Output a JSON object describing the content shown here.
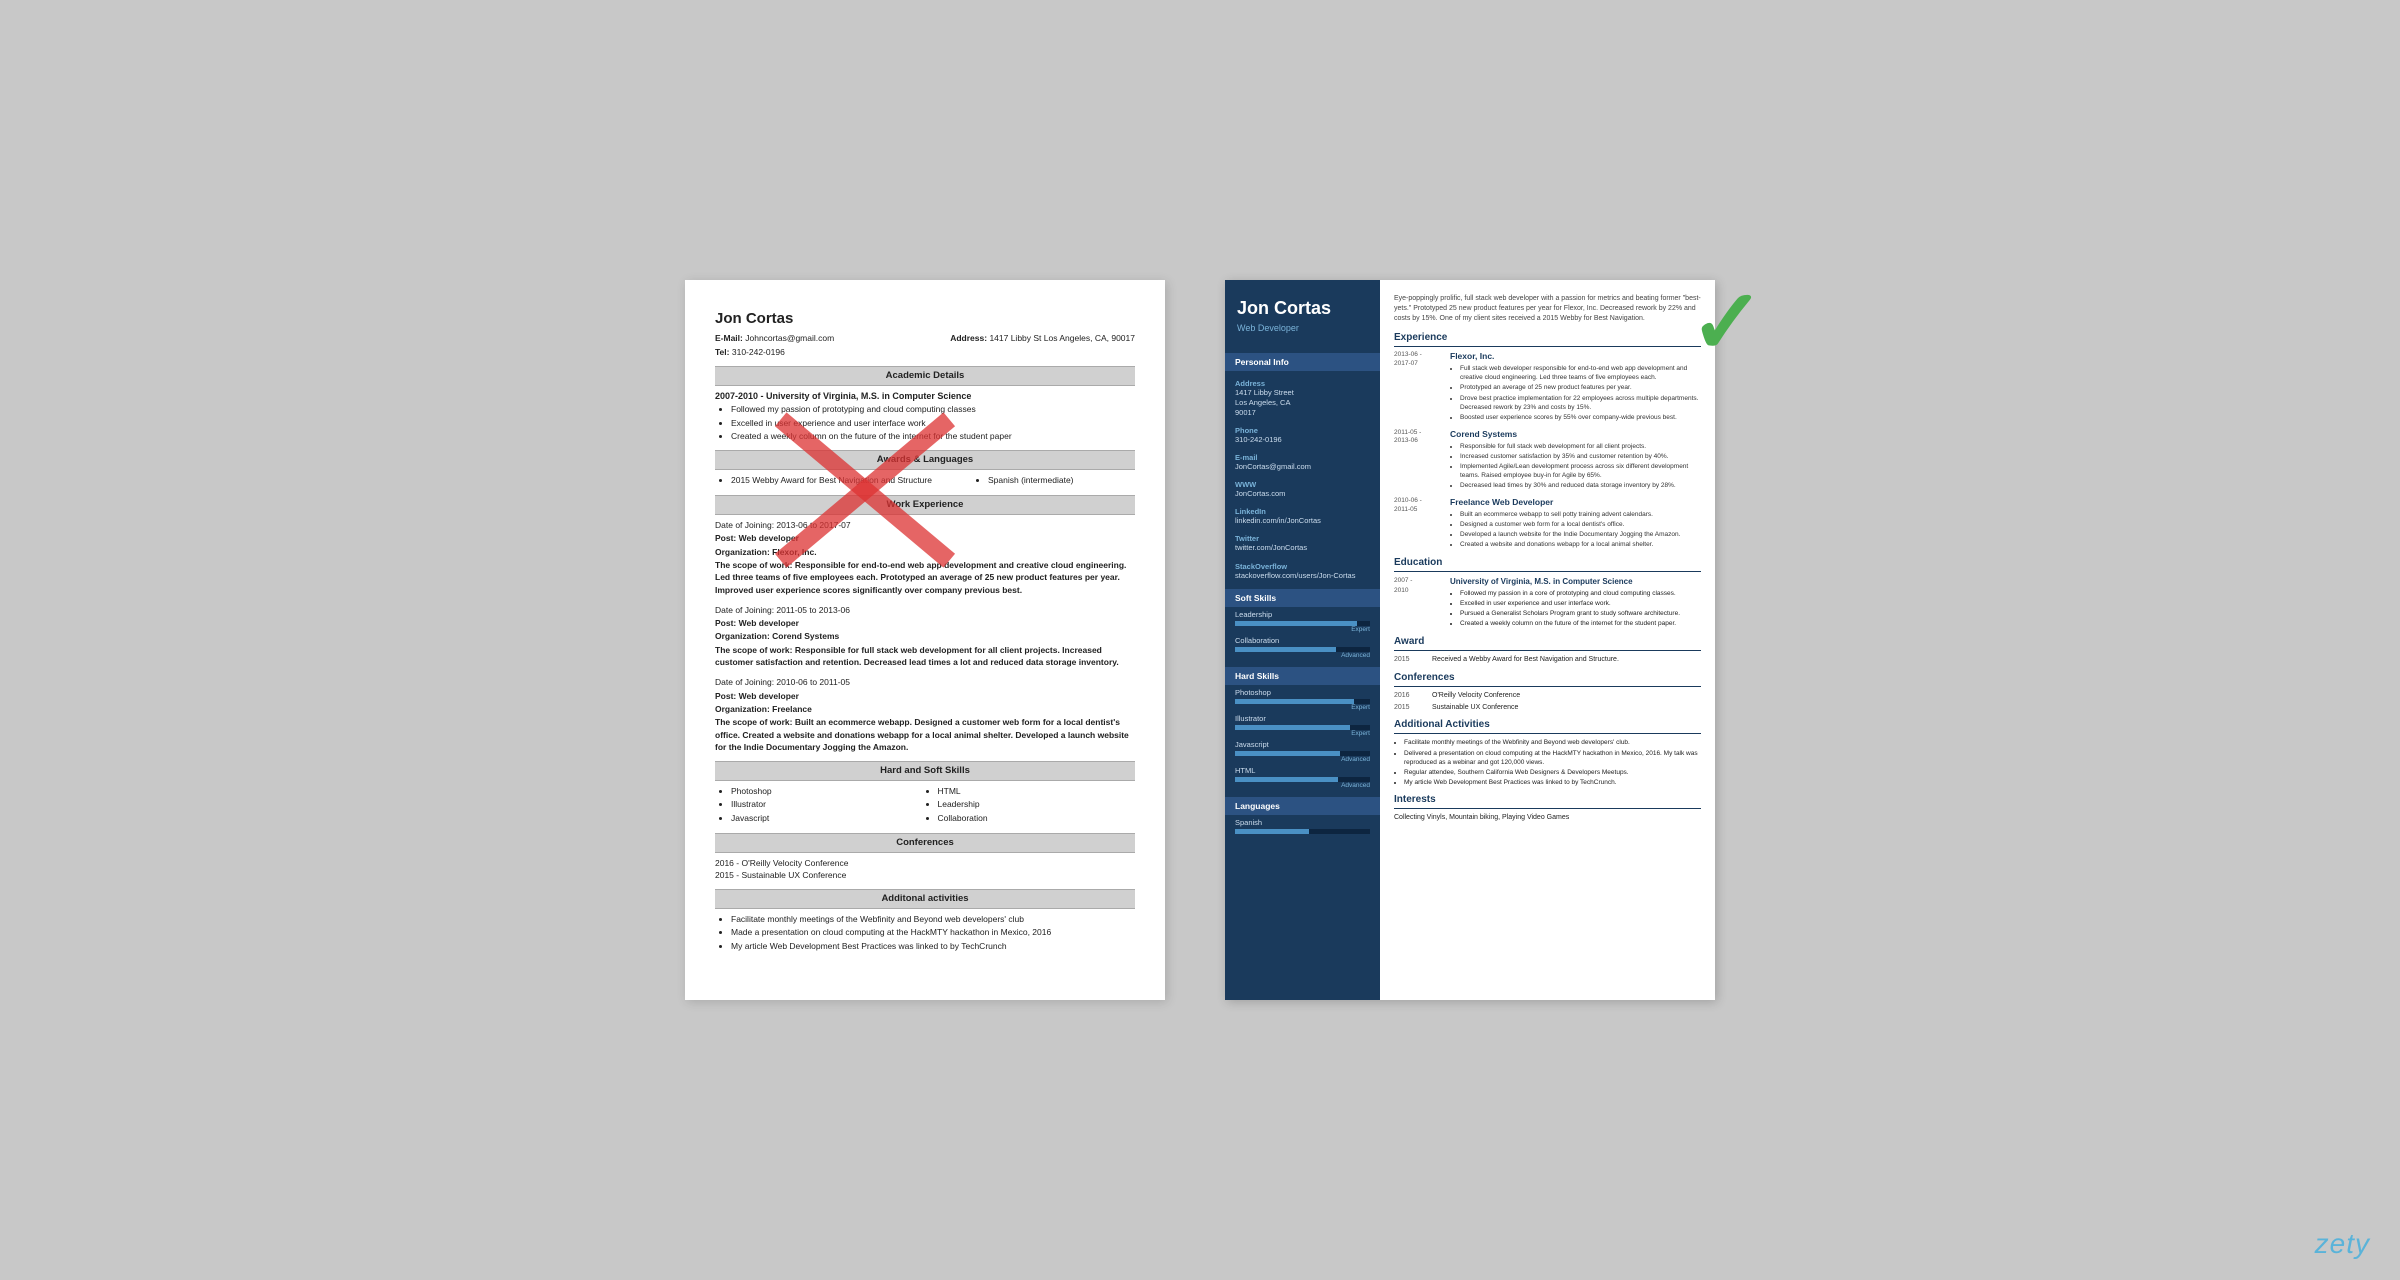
{
  "left_resume": {
    "name": "Jon Cortas",
    "email_label": "E-Mail:",
    "email": "Johncortas@gmail.com",
    "address_label": "Address:",
    "address": "1417 Libby St Los Angeles, CA, 90017",
    "tel_label": "Tel:",
    "tel": "310-242-0196",
    "sections": {
      "academic": {
        "title": "Academic Details",
        "item": "2007-2010 - University of Virginia, M.S. in Computer Science",
        "bullets": [
          "Followed my passion of prototyping and cloud computing classes",
          "Excelled in user experience and user interface work",
          "Created a weekly column on the future of the internet for the student paper"
        ]
      },
      "awards": {
        "title": "Awards & Languages",
        "award": "2015 Webby Award for Best Navigation and Structure",
        "language": "Spanish (intermediate)"
      },
      "work": {
        "title": "Work Experience",
        "jobs": [
          {
            "dates": "Date of Joining: 2013-06 to 2017-07",
            "post": "Post: Web developer",
            "org": "Organization: Flexor, Inc.",
            "scope_label": "The scope of work:",
            "scope": "Responsible for end-to-end web app development and creative cloud engineering. Led three teams of five employees each. Prototyped an average of 25 new product features per year. Improved user experience scores significantly over company previous best."
          },
          {
            "dates": "Date of Joining: 2011-05 to 2013-06",
            "post": "Post: Web developer",
            "org": "Organization: Corend Systems",
            "scope_label": "The scope of work:",
            "scope": "Responsible for full stack web development for all client projects. Increased customer satisfaction and retention. Decreased lead times a lot and reduced data storage inventory."
          },
          {
            "dates": "Date of Joining: 2010-06 to 2011-05",
            "post": "Post: Web developer",
            "org": "Organization: Freelance",
            "scope_label": "The scope of work:",
            "scope": "Built an ecommerce webapp. Designed a customer web form for a local dentist's office. Created a website and donations webapp for a local animal shelter. Developed a launch website for the Indie Documentary Jogging the Amazon."
          }
        ]
      },
      "skills": {
        "title": "Hard and Soft Skills",
        "items": [
          "Photoshop",
          "Illustrator",
          "Javascript",
          "HTML",
          "Leadership",
          "Collaboration"
        ]
      },
      "conferences": {
        "title": "Conferences",
        "items": [
          "2016 - O'Reilly Velocity Conference",
          "2015 - Sustainable UX Conference"
        ]
      },
      "activities": {
        "title": "Additonal activities",
        "bullets": [
          "Facilitate monthly meetings of the Webfinity and Beyond web developers' club",
          "Made a presentation on cloud computing at the HackMTY hackathon in Mexico, 2016",
          "My article Web Development Best Practices was linked to by TechCrunch"
        ]
      }
    }
  },
  "right_resume": {
    "name": "Jon Cortas",
    "title": "Web Developer",
    "summary": "Eye-poppingly prolific, full stack web developer with a passion for metrics and beating former \"best-yets.\" Prototyped 25 new product features per year for Flexor, Inc. Decreased rework by 22% and costs by 15%. One of my client sites received a 2015 Webby for Best Navigation.",
    "sidebar": {
      "personal_info_title": "Personal Info",
      "address_label": "Address",
      "address": "1417 Libby Street\nLos Angeles, CA\n90017",
      "phone_label": "Phone",
      "phone": "310-242-0196",
      "email_label": "E-mail",
      "email": "JonCortas@gmail.com",
      "www_label": "WWW",
      "www": "JonCortas.com",
      "linkedin_label": "LinkedIn",
      "linkedin": "linkedin.com/in/JonCortas",
      "twitter_label": "Twitter",
      "twitter": "twitter.com/JonCortas",
      "stackoverflow_label": "StackOverflow",
      "stackoverflow": "stackoverflow.com/users/Jon-Cortas",
      "soft_skills_title": "Soft Skills",
      "soft_skills": [
        {
          "name": "Leadership",
          "level": "Expert",
          "pct": 90
        },
        {
          "name": "Collaboration",
          "level": "Advanced",
          "pct": 75
        }
      ],
      "hard_skills_title": "Hard Skills",
      "hard_skills": [
        {
          "name": "Photoshop",
          "level": "Expert",
          "pct": 88
        },
        {
          "name": "Illustrator",
          "level": "Expert",
          "pct": 85
        },
        {
          "name": "Javascript",
          "level": "Advanced",
          "pct": 78
        },
        {
          "name": "HTML",
          "level": "Advanced",
          "pct": 76
        }
      ],
      "languages_title": "Languages",
      "languages": [
        {
          "name": "Spanish",
          "pct": 55
        }
      ]
    },
    "experience_title": "Experience",
    "jobs": [
      {
        "start": "2013-06 -",
        "end": "2017-07",
        "company": "Flexor, Inc.",
        "bullets": [
          "Full stack web developer responsible for end-to-end web app development and creative cloud engineering. Led three teams of five employees each.",
          "Prototyped an average of 25 new product features per year.",
          "Drove best practice implementation for 22 employees across multiple departments. Decreased rework by 23% and costs by 15%.",
          "Boosted user experience scores by 55% over company-wide previous best."
        ]
      },
      {
        "start": "2011-05 -",
        "end": "2013-06",
        "company": "Corend Systems",
        "bullets": [
          "Responsible for full stack web development for all client projects.",
          "Increased customer satisfaction by 35% and customer retention by 40%.",
          "Implemented Agile/Lean development process across six different development teams. Raised employee buy-in for Agile by 65%.",
          "Decreased lead times by 30% and reduced data storage inventory by 28%."
        ]
      },
      {
        "start": "2010-06 -",
        "end": "2011-05",
        "company": "Freelance Web Developer",
        "bullets": [
          "Built an ecommerce webapp to sell potty training advent calendars.",
          "Designed a customer web form for a local dentist's office.",
          "Developed a launch website for the Indie Documentary Jogging the Amazon.",
          "Created a website and donations webapp for a local animal shelter."
        ]
      }
    ],
    "education_title": "Education",
    "education": [
      {
        "start": "2007 -",
        "end": "2010",
        "school": "University of Virginia, M.S. in Computer Science",
        "bullets": [
          "Followed my passion in a core of prototyping and cloud computing classes.",
          "Excelled in user experience and user interface work.",
          "Pursued a Generalist Scholars Program grant to study software architecture.",
          "Created a weekly column on the future of the internet for the student paper."
        ]
      }
    ],
    "award_title": "Award",
    "awards": [
      {
        "year": "2015",
        "text": "Received a Webby Award for Best Navigation and Structure."
      }
    ],
    "conferences_title": "Conferences",
    "conferences": [
      {
        "year": "2016",
        "name": "O'Reilly Velocity Conference"
      },
      {
        "year": "2015",
        "name": "Sustainable UX Conference"
      }
    ],
    "activities_title": "Additional Activities",
    "activities": [
      "Facilitate monthly meetings of the Webfinity and Beyond web developers' club.",
      "Delivered a presentation on cloud computing at the HackMTY hackathon in Mexico, 2016. My talk was reproduced as a webinar and got 120,000 views.",
      "Regular attendee, Southern California Web Designers & Developers Meetups.",
      "My article Web Development Best Practices was linked to by TechCrunch."
    ],
    "interests_title": "Interests",
    "interests": "Collecting Vinyls, Mountain biking, Playing Video Games"
  },
  "zety_label": "zety"
}
